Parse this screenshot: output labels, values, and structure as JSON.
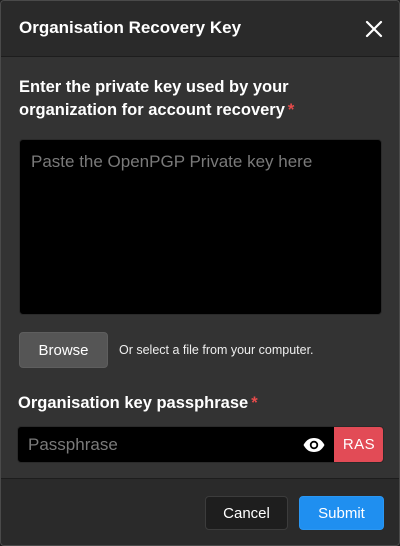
{
  "dialog": {
    "title": "Organisation Recovery Key",
    "close_icon": "close-icon"
  },
  "private_key": {
    "label": "Enter the private key used by your organization for account recovery",
    "required_mark": "*",
    "placeholder": "Paste the OpenPGP Private key here",
    "value": ""
  },
  "file": {
    "browse_label": "Browse",
    "hint": "Or select a file from your computer."
  },
  "passphrase": {
    "label": "Organisation key passphrase",
    "required_mark": "*",
    "placeholder": "Passphrase",
    "value": "",
    "visibility_icon": "eye-icon",
    "badge": "RAS",
    "badge_color": "#e24b56"
  },
  "footer": {
    "cancel_label": "Cancel",
    "submit_label": "Submit"
  },
  "colors": {
    "accent": "#1f8ff0",
    "required": "#e74b4b",
    "panel": "#333333",
    "header": "#2a2a2a"
  }
}
